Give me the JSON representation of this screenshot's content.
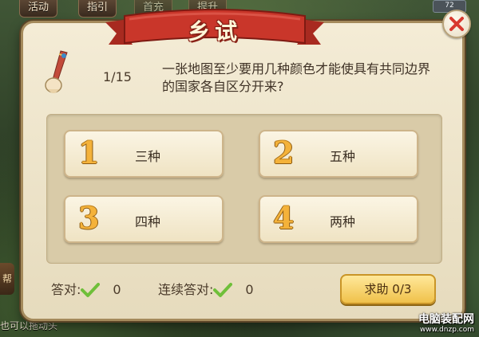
{
  "top_menu": {
    "tabs": [
      "活动",
      "指引",
      "首充",
      "提升"
    ],
    "indicator": "72"
  },
  "side_tab": "帮",
  "bottom_left_text": "也可以拖动头",
  "dialog": {
    "title": "乡试",
    "question": {
      "counter": "1/15",
      "text": "一张地图至少要用几种颜色才能使具有共同边界的国家各自区分开来?"
    },
    "options": [
      {
        "number": "1",
        "label": "三种"
      },
      {
        "number": "2",
        "label": "五种"
      },
      {
        "number": "3",
        "label": "四种"
      },
      {
        "number": "4",
        "label": "两种"
      }
    ],
    "stats": {
      "correct_label": "答对:",
      "correct_value": "0",
      "streak_label": "连续答对:",
      "streak_value": "0"
    },
    "help_button": "求助 0/3"
  },
  "watermark": {
    "main": "电脑装配网",
    "url": "www.dnzp.com"
  },
  "colors": {
    "ribbon_red": "#c9362a",
    "number_gold": "#f4b23a",
    "check_green": "#6fbf3a",
    "close_red": "#d8392f"
  }
}
